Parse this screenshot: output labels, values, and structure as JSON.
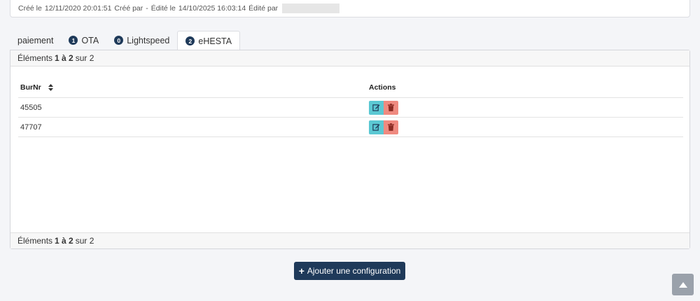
{
  "meta": {
    "created_label": "Créé le",
    "created_date": "12/11/2020 20:01:51",
    "created_by_label": "Créé par",
    "created_by_value": "-",
    "edited_label": "Édité le",
    "edited_date": "14/10/2025 16:03:14",
    "edited_by_label": "Édité par"
  },
  "tabs": [
    {
      "label": "paiement",
      "badge": ""
    },
    {
      "label": "OTA",
      "badge": "1"
    },
    {
      "label": "Lightspeed",
      "badge": "0"
    },
    {
      "label": "eHESTA",
      "badge": "2",
      "active": true
    }
  ],
  "pagination": {
    "prefix": "Éléments",
    "range": "1 à 2",
    "suffix": "sur 2"
  },
  "table": {
    "columns": [
      "BurNr",
      "Actions"
    ],
    "rows": [
      {
        "burnr": "45505"
      },
      {
        "burnr": "47707"
      }
    ]
  },
  "add_button": {
    "label": "Ajouter une configuration"
  },
  "colors": {
    "primary": "#1f3a5a",
    "edit": "#5bc8d3",
    "delete": "#ef8a80",
    "scroll_top": "#9aa1ab"
  },
  "icons": {
    "edit": "edit-icon",
    "delete": "trash-icon",
    "sort": "sort-icon",
    "plus": "plus-icon",
    "scroll_top": "chevron-up-icon"
  }
}
